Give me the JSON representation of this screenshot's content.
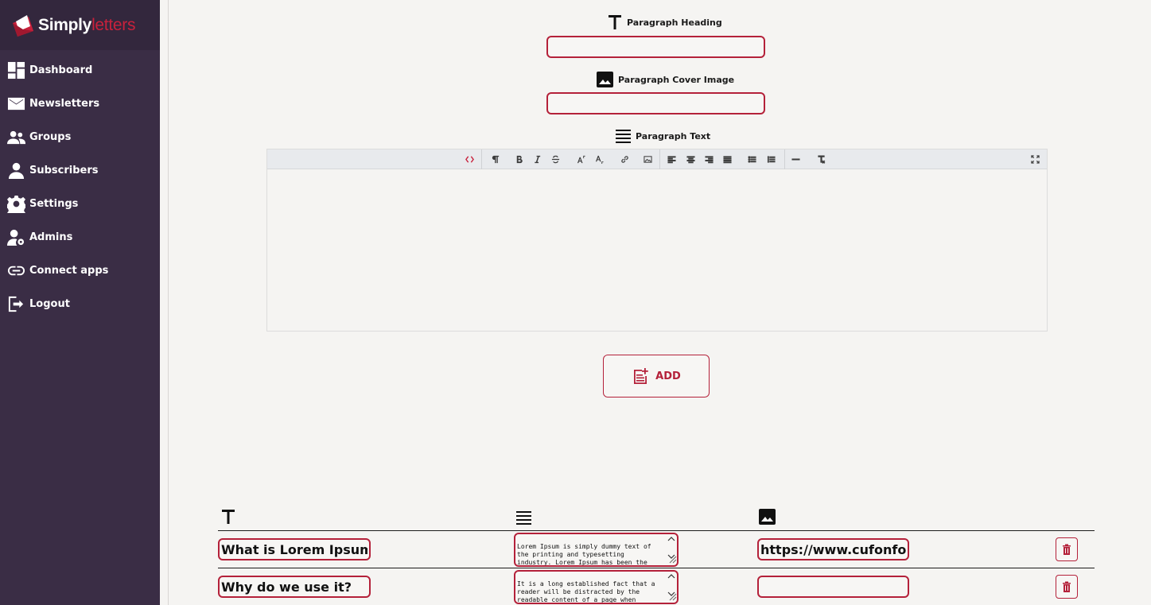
{
  "brand": {
    "name_part1": "Simply",
    "name_part2": "letters"
  },
  "sidebar": {
    "items": [
      {
        "label": "Dashboard",
        "icon": "dashboard-icon"
      },
      {
        "label": "Newsletters",
        "icon": "envelope-icon"
      },
      {
        "label": "Groups",
        "icon": "users-icon"
      },
      {
        "label": "Subscribers",
        "icon": "user-icon"
      },
      {
        "label": "Settings",
        "icon": "gear-icon"
      },
      {
        "label": "Admins",
        "icon": "user-gear-icon"
      },
      {
        "label": "Connect apps",
        "icon": "link-icon"
      },
      {
        "label": "Logout",
        "icon": "logout-icon"
      }
    ]
  },
  "form": {
    "heading_label": "Paragraph Heading",
    "heading_value": "",
    "cover_label": "Paragraph Cover Image",
    "cover_value": "",
    "text_label": "Paragraph Text",
    "add_label": "ADD"
  },
  "editor": {
    "toolbar": [
      "code-view",
      "paragraph-format",
      "bold",
      "italic",
      "strikethrough",
      "superscript",
      "subscript",
      "insert-link",
      "insert-image",
      "align-left",
      "align-center",
      "align-right",
      "align-justify",
      "unordered-list",
      "ordered-list",
      "horizontal-line",
      "clear-formatting",
      "fullscreen"
    ]
  },
  "rows": [
    {
      "heading": "What is Lorem Ipsum?",
      "text": "Lorem Ipsum is simply dummy text of the printing and typesetting industry. Lorem Ipsum has been the",
      "cover": "https://www.cufonfont"
    },
    {
      "heading": "Why do we use it?",
      "text": "It is a long established fact that a reader will be distracted by the readable content of a page when",
      "cover": ""
    }
  ],
  "colors": {
    "accent": "#b4213a",
    "sidebar": "#3a2d45",
    "background": "#f5f4f2"
  }
}
